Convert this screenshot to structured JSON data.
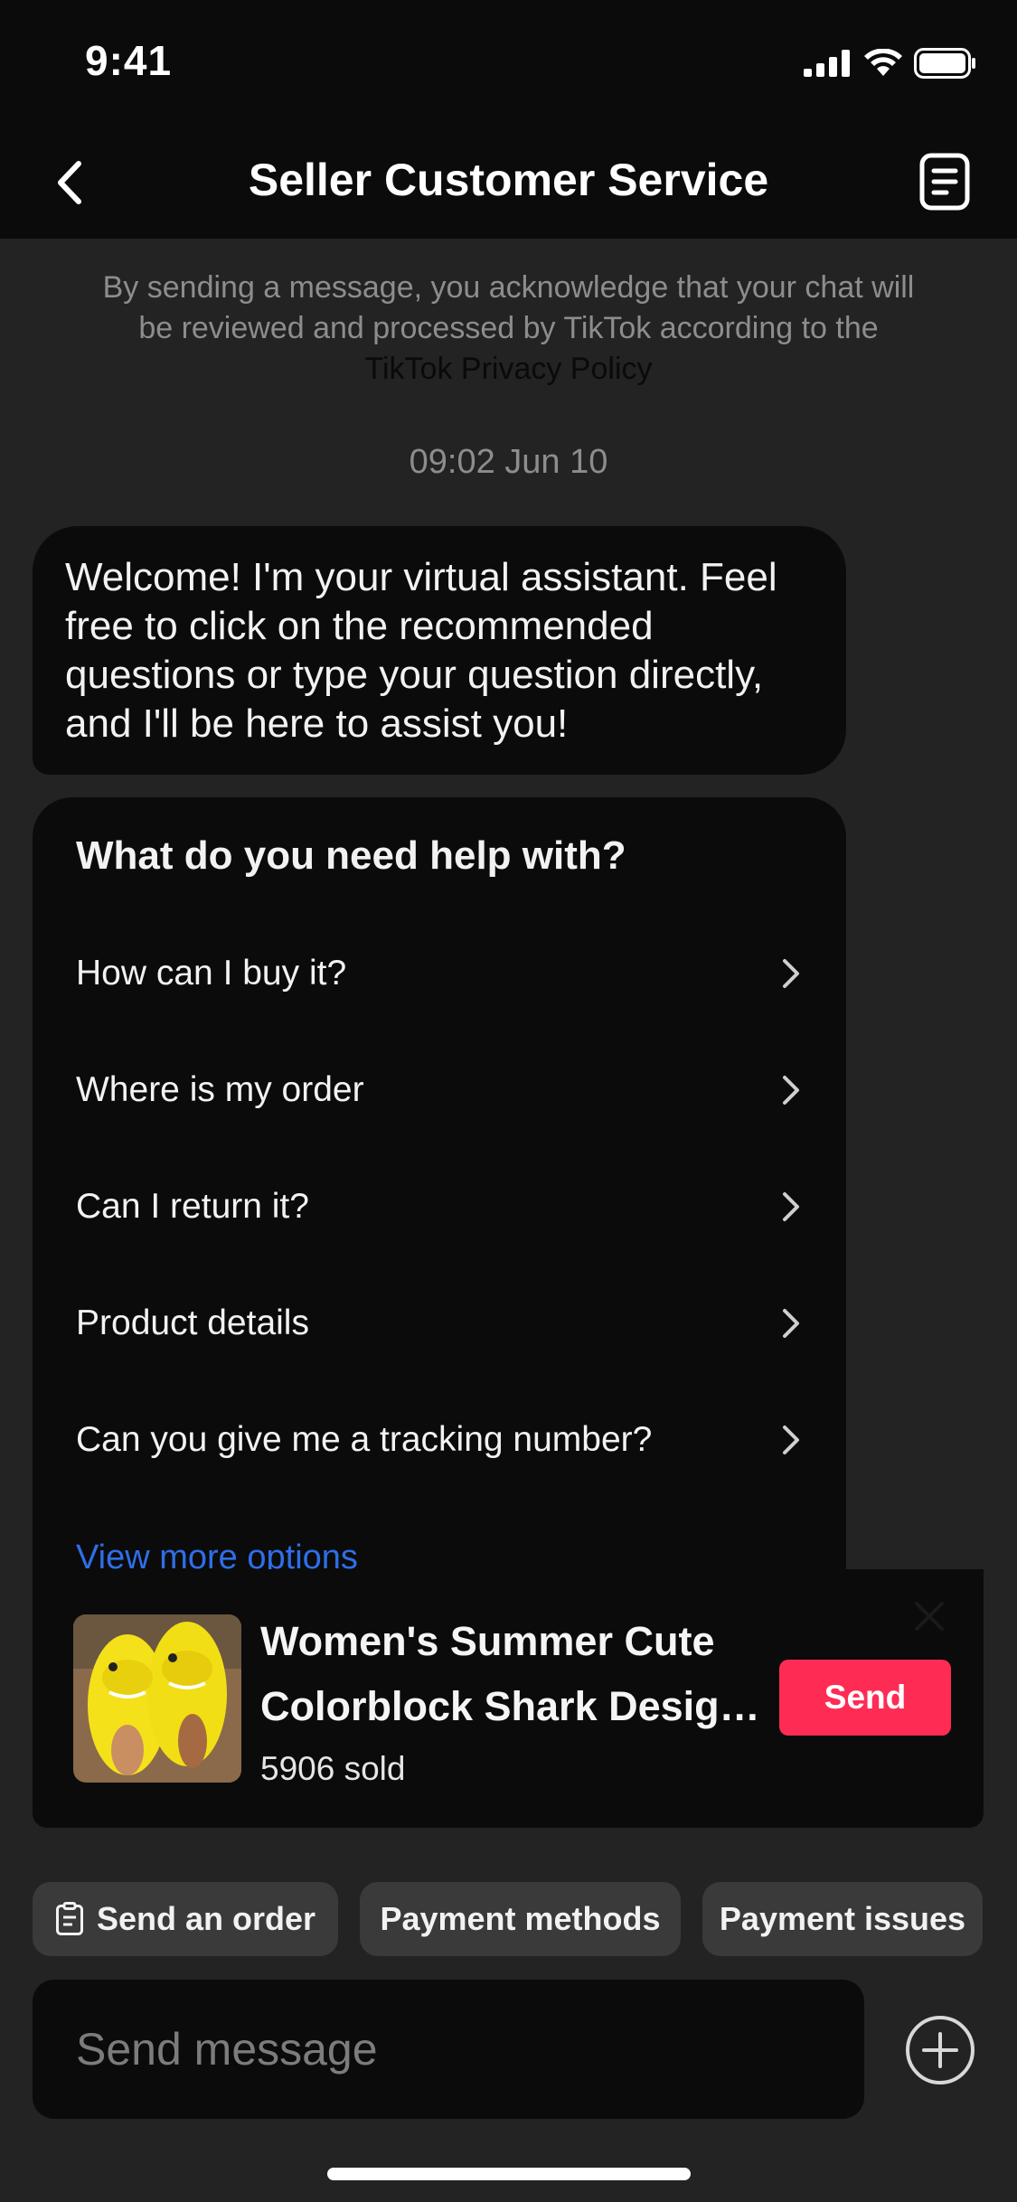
{
  "status_bar": {
    "time": "9:41"
  },
  "nav": {
    "title": "Seller Customer Service"
  },
  "notice": {
    "text": "By sending a message, you acknowledge that your chat will be reviewed and processed by TikTok according to the",
    "link": "TikTok Privacy Policy"
  },
  "timestamp": "09:02 Jun 10",
  "welcome_message": "Welcome! I'm your virtual assistant. Feel free to click on the recommended questions or type your question directly, and I'll be here to assist you!",
  "help": {
    "title": "What do you need help with?",
    "items": [
      "How can I buy it?",
      "Where is my order",
      "Can I return it?",
      "Product details",
      "Can you give me a tracking number?"
    ],
    "more_link": "View more options"
  },
  "product": {
    "title_line1": "Women's Summer Cute",
    "title_line2": "Colorblock Shark Design…",
    "sold": "5906 sold",
    "send_label": "Send"
  },
  "quick_actions": [
    "Send an order",
    "Payment methods",
    "Payment issues"
  ],
  "composer": {
    "placeholder": "Send message"
  },
  "colors": {
    "accent": "#fe2c55",
    "link": "#2f6ee8",
    "background": "#232323",
    "surface": "#0b0b0b"
  }
}
